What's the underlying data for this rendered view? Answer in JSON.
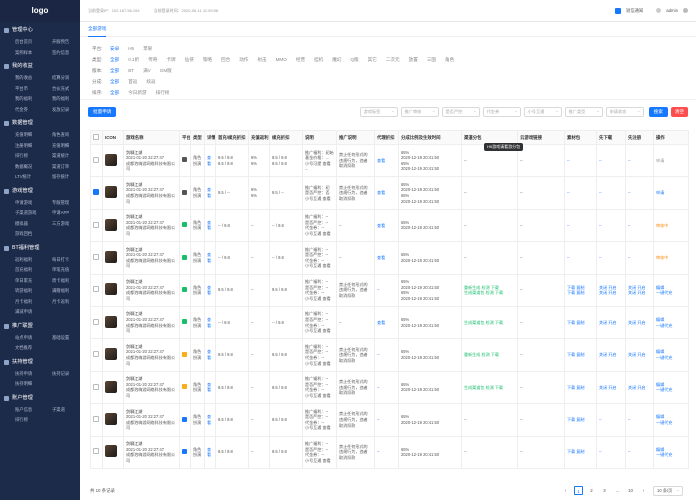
{
  "logo": "logo",
  "sidebar": [
    {
      "title": "管理中心",
      "items": [
        "后台首页",
        "开服预告",
        "案例样本",
        "签约信息"
      ]
    },
    {
      "title": "我的收益",
      "items": [
        "我的收益",
        "结算分润",
        "平台币",
        "合伙充式",
        "我的福利",
        "我的福利",
        "代金券",
        "发放记录"
      ]
    },
    {
      "title": "数据管理",
      "items": [
        "充值明细",
        "角色查询",
        "注册明细",
        "充值明细",
        "排行榜",
        "渠道统计",
        "数据概况",
        "渠道订单",
        "LTV统计",
        "留存统计"
      ]
    },
    {
      "title": "游戏管理",
      "items": [
        "申请游戏",
        "专服管理",
        "子渠道游戏",
        "申请APP",
        "模拟器",
        "三方游戏",
        "游戏回档"
      ]
    },
    {
      "title": "BT福利管理",
      "items": [
        "返利福利",
        "每日打卡",
        "首充福利",
        "单笔充值",
        "单日累充",
        "周卡福利",
        "转游福利",
        "满赠福利",
        "月卡福利",
        "月卡返利",
        "满减申请"
      ]
    },
    {
      "title": "推广联盟",
      "items": [
        "站点申请",
        "基础设置",
        "文档推荐"
      ]
    },
    {
      "title": "扶持管理",
      "items": [
        "扶持申请",
        "扶持记录",
        "扶持明细"
      ]
    },
    {
      "title": "账户管理",
      "items": [
        "账户信息",
        "子渠道",
        "排行榜"
      ]
    }
  ],
  "topbar": {
    "last_ip": "当前登录IP：102.187.56.154",
    "last_time": "当前登录时间：2020-06-11 11:09:06",
    "notice": "短信通知",
    "admin": "admin"
  },
  "tab": "全部游戏",
  "filters": [
    {
      "label": "平台:",
      "options": [
        "安卓",
        "H5",
        "苹果"
      ]
    },
    {
      "label": "类型:",
      "options": [
        "全部",
        "0.1折",
        "传奇",
        "卡牌",
        "仙侠",
        "策略",
        "回合",
        "动作",
        "射击",
        "MMO",
        "经营",
        "挂机",
        "魔幻",
        "Q版",
        "其它",
        "二次元",
        "放置",
        "三国",
        "角色"
      ]
    },
    {
      "label": "版本:",
      "options": [
        "全部",
        "BT",
        "满V",
        "GM版"
      ]
    },
    {
      "label": "分成:",
      "options": [
        "全部",
        "首返",
        "续返"
      ]
    },
    {
      "label": "排序:",
      "options": [
        "全部",
        "今日新游",
        "排行榜"
      ]
    }
  ],
  "toolbar": {
    "batch": "批量申请",
    "selects": [
      "游戏标签",
      "推广审核",
      "是否严控",
      "代金券",
      "小号互通",
      "推广类型",
      "申请状态"
    ],
    "search": "搜索",
    "clear": "清空"
  },
  "headers": [
    "",
    "ICON",
    "游戏名称",
    "平台",
    "类型",
    "详情",
    "首充/续充折扣",
    "充值返利",
    "续充折扣",
    "说明",
    "推广说明",
    "代理折扣",
    "分成比例及生效时间",
    "渠道分包",
    "云游戏链接",
    "素材包",
    "先下载",
    "先注册",
    "操作"
  ],
  "tooltip": "H5游戏请看游分包",
  "rows": [
    {
      "checked": false,
      "name": "剑聊江湖",
      "time": "2021-01-20 22:27:47",
      "dev": "成都泡嗨游网络科技有限公司",
      "type": "角色\n扮演",
      "detail": "查看",
      "first": "9.5 / 9.8\n9.5 / 9.8",
      "rebate": "6%\n6%",
      "cont": "9.5 / 9.8\n9.5 / 9.8",
      "note": "推广福利：初始\n基金价格：…\n小号可提 查看\n...",
      "promo": "禁止任何形式的\n违规行为，违者\n取消扣款",
      "agent": "查看",
      "share": "65%\n2020-12-19 20:41:50\n65%\n2020-12-19 20:41:50",
      "sub": "--",
      "cloud": "--",
      "mat": "--",
      "dl": "--",
      "reg": "--",
      "op": "申请",
      "opcolor": "gray",
      "plat": "apple"
    },
    {
      "checked": true,
      "name": "剑聊江湖",
      "time": "2021-01-20 22:27:47",
      "dev": "成都泡嗨游网络科技有限公司",
      "type": "角色\n扮演",
      "detail": "查看",
      "first": "9.5 / --",
      "rebate": "6%\n6%",
      "cont": "9.5 / --",
      "note": "推广福利：初\n是否严控：否\n小号互通 查看",
      "promo": "禁止任何形式的\n违规行为，违者\n取消扣款",
      "agent": "查看",
      "share": "65%\n2020-12-19 20:41:50\n65%\n2020-12-19 20:41:50",
      "sub": "--",
      "cloud": "--",
      "mat": "--",
      "dl": "--",
      "reg": "--",
      "op": "申请",
      "opcolor": "blue",
      "plat": "apple"
    },
    {
      "checked": false,
      "name": "剑聊江湖",
      "time": "2021-01-20 22:27:47",
      "dev": "成都泡嗨游网络科技有限公司",
      "type": "角色\n扮演",
      "detail": "查看",
      "first": "-- / 9.8",
      "rebate": "--",
      "cont": "-- / 9.8",
      "note": "推广福利：--\n是否严控：--\n代金券：--\n小号互通 查看",
      "promo": "--",
      "agent": "查看",
      "share": "65%\n2020-12-19 20:41:50",
      "sub": "--",
      "cloud": "--",
      "mat": "--",
      "dl": "--",
      "reg": "--",
      "op": "审核中",
      "opcolor": "orange",
      "plat": "android"
    },
    {
      "checked": false,
      "name": "剑聊江湖",
      "time": "2021-01-20 22:27:47",
      "dev": "成都泡嗨游网络科技有限公司",
      "type": "角色\n扮演",
      "detail": "查看",
      "first": "-- / 9.8",
      "rebate": "--",
      "cont": "-- / 9.8",
      "note": "推广福利：--\n是否严控：--\n代金券：--\n小号互通 查看",
      "promo": "--",
      "agent": "查看",
      "share": "65%\n2020-12-19 20:41:50",
      "sub": "--",
      "cloud": "--",
      "mat": "--",
      "dl": "--",
      "reg": "--",
      "op": "审核中",
      "opcolor": "orange",
      "plat": "android"
    },
    {
      "checked": false,
      "name": "剑聊江湖",
      "time": "2021-01-20 22:27:47",
      "dev": "成都泡嗨游网络科技有限公司",
      "type": "角色\n扮演",
      "detail": "查看",
      "first": "9.5 / 9.8",
      "rebate": "--",
      "cont": "9.5 / 9.8",
      "note": "推广福利：--\n是否严控：--\n代金券：--\n小号互通 查看",
      "promo": "禁止任何形式的\n违规行为，违者\n取消扣款",
      "agent": "--",
      "share": "65%\n2020-12-19 20:41:50\n65%\n2020-12-19 20:41:50",
      "sub": "重新生成  检测  下载\n生成渠道包  检测  下载",
      "cloud": "--",
      "mat": "下载  复制\n下载  复制",
      "dl": "关闭 开启\n关闭 开启",
      "reg": "关闭 开启\n关闭 开启",
      "op": "编辑\n一键代充",
      "opcolor": "blue",
      "plat": "android",
      "pack": true
    },
    {
      "checked": false,
      "name": "剑聊江湖",
      "time": "2021-01-20 22:27:47",
      "dev": "成都泡嗨游网络科技有限公司",
      "type": "角色\n扮演",
      "detail": "查看",
      "first": "-- / 9.8",
      "rebate": "--",
      "cont": "-- / 9.8",
      "note": "推广福利：--\n是否严控：--\n代金券：--\n小号互通 查看",
      "promo": "--",
      "agent": "查看",
      "share": "65%\n2020-12-19 20:41:50",
      "sub": "生成渠道包  检测  下载",
      "cloud": "--",
      "mat": "下载  复制",
      "dl": "关闭 开启",
      "reg": "关闭 开启",
      "op": "编辑\n一键代充",
      "opcolor": "blue",
      "plat": "android",
      "pack": true
    },
    {
      "checked": false,
      "name": "剑聊江湖",
      "time": "2021-01-20 22:27:47",
      "dev": "成都泡嗨游网络科技有限公司",
      "type": "角色\n扮演",
      "detail": "查看",
      "first": "9.5 / 9.8",
      "rebate": "--",
      "cont": "9.5 / 9.8",
      "note": "推广福利：--\n是否严控：--\n代金券：--\n小号互通 查看",
      "promo": "禁止任何形式的\n违规行为，违者\n取消扣款",
      "agent": "--",
      "share": "65%\n2020-12-19 20:41:50",
      "sub": "重新生成  检测  下载",
      "cloud": "--",
      "mat": "下载  复制",
      "dl": "关闭 开启",
      "reg": "关闭 开启",
      "op": "编辑\n一键代充",
      "opcolor": "blue",
      "plat": "h5",
      "pack": true
    },
    {
      "checked": false,
      "name": "剑聊江湖",
      "time": "2021-01-20 22:27:47",
      "dev": "成都泡嗨游网络科技有限公司",
      "type": "角色\n扮演",
      "detail": "查看",
      "first": "9.5 / 9.8",
      "rebate": "--",
      "cont": "9.5 / 9.8",
      "note": "推广福利：--\n是否严控：--\n代金券：--\n小号互通 查看",
      "promo": "禁止任何形式的\n违规行为，违者\n取消扣款",
      "agent": "--",
      "share": "65%\n2020-12-19 20:41:50",
      "sub": "生成渠道包  检测  下载",
      "cloud": "--",
      "mat": "下载  复制",
      "dl": "关闭 开启",
      "reg": "关闭 开启",
      "op": "编辑\n一键代充",
      "opcolor": "blue",
      "plat": "h5",
      "pack": true
    },
    {
      "checked": false,
      "name": "剑聊江湖",
      "time": "2021-01-20 22:27:47",
      "dev": "成都泡嗨游网络科技有限公司",
      "type": "角色\n扮演",
      "detail": "查看",
      "first": "9.5 / 9.8",
      "rebate": "--",
      "cont": "9.5 / 9.8",
      "note": "推广福利：--\n是否严控：--\n代金券：--\n小号互通 查看",
      "promo": "禁止任何形式的\n违规行为，违者\n取消扣款",
      "agent": "--",
      "share": "65%\n2020-12-19 20:41:50",
      "sub": "--",
      "cloud": "--",
      "mat": "下载  复制",
      "dl": "--",
      "reg": "--",
      "op": "编辑\n一键代充",
      "opcolor": "blue",
      "plat": "screen"
    },
    {
      "checked": false,
      "name": "剑聊江湖",
      "time": "2021-01-20 22:27:47",
      "dev": "成都泡嗨游网络科技有限公司",
      "type": "角色\n扮演",
      "detail": "查看",
      "first": "9.5 / 9.8",
      "rebate": "--",
      "cont": "9.5 / 9.8",
      "note": "推广福利：--\n是否严控：--\n代金券：--\n小号互通 查看",
      "promo": "禁止任何形式的\n违规行为，违者\n取消扣款",
      "agent": "--",
      "share": "65%\n2020-12-19 20:41:50",
      "sub": "--",
      "cloud": "--",
      "mat": "下载  复制",
      "dl": "--",
      "reg": "--",
      "op": "编辑\n一键代充",
      "opcolor": "blue",
      "plat": "screen"
    }
  ],
  "pager": {
    "total": "共 10 条记录",
    "pages": [
      "‹",
      "1",
      "2",
      "3",
      "...",
      "10",
      "›"
    ],
    "size": "10 条/页"
  },
  "colors": {
    "primary": "#1677ff",
    "danger": "#ff4d4f",
    "sidebar": "#1d2b4b"
  }
}
